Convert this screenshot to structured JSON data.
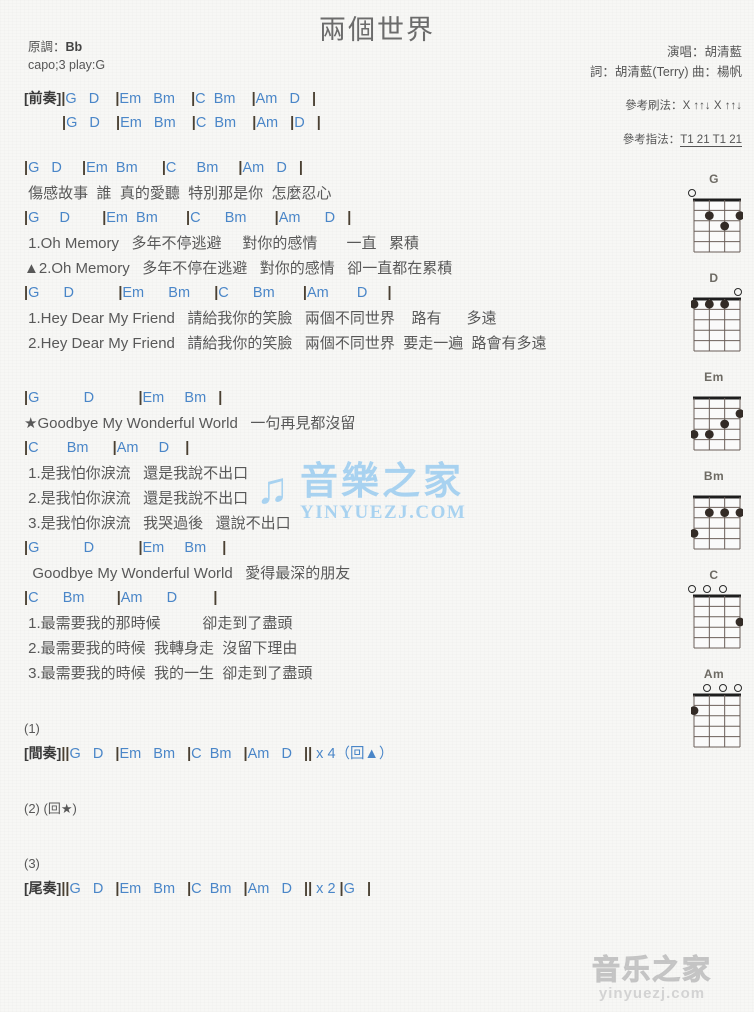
{
  "title": "兩個世界",
  "meta_left": {
    "key_label": "原調：",
    "key_value": "Bb",
    "capo": "capo;3 play:G"
  },
  "meta_right": {
    "singer": "演唱：胡清藍",
    "writer": "詞：胡清藍(Terry)  曲：楊帆",
    "strum_label": "參考刷法：",
    "strum_pattern": "X ↑↑↓ X ↑↑↓",
    "pick_label": "參考指法：",
    "pick_pattern": "T1 21 T1 21"
  },
  "sections": [
    {
      "tag": "[前奏]",
      "lines": [
        {
          "type": "chord",
          "text": "|G   D    |Em   Bm    |C  Bm    |Am   D   |"
        },
        {
          "type": "chord",
          "indent": true,
          "text": "|G   D    |Em   Bm    |C  Bm    |Am   |D   |"
        }
      ]
    },
    {
      "tag": "",
      "lines": [
        {
          "type": "chord",
          "text": "|G   D     |Em  Bm      |C     Bm     |Am   D   |"
        },
        {
          "type": "lyric",
          "text": " 傷感故事  誰  真的愛聽  特別那是你  怎麼忍心"
        },
        {
          "type": "chord",
          "text": "|G     D        |Em  Bm       |C      Bm       |Am      D   |"
        },
        {
          "type": "lyric",
          "text": " 1.Oh Memory   多年不停逃避     對你的感情       一直   累積"
        },
        {
          "type": "lyric",
          "text": "▲2.Oh Memory   多年不停在逃避   對你的感情   卻一直都在累積"
        },
        {
          "type": "chord",
          "text": "|G      D           |Em      Bm      |C      Bm       |Am       D     |"
        },
        {
          "type": "lyric",
          "text": " 1.Hey Dear My Friend   請給我你的笑臉   兩個不同世界    路有      多遠"
        },
        {
          "type": "lyric",
          "text": " 2.Hey Dear My Friend   請給我你的笑臉   兩個不同世界  要走一遍  路會有多遠"
        }
      ]
    },
    {
      "tag": "",
      "lines": [
        {
          "type": "chord",
          "text": "|G           D           |Em     Bm   |"
        },
        {
          "type": "lyric",
          "text": "★Goodbye My Wonderful World   一句再見都沒留"
        },
        {
          "type": "chord",
          "text": "|C       Bm      |Am     D    |"
        },
        {
          "type": "lyric",
          "text": " 1.是我怕你淚流   還是我說不出口"
        },
        {
          "type": "lyric",
          "text": " 2.是我怕你淚流   還是我說不出口"
        },
        {
          "type": "lyric",
          "text": " 3.是我怕你淚流   我哭過後   還說不出口"
        },
        {
          "type": "chord",
          "text": "|G           D           |Em     Bm    |"
        },
        {
          "type": "lyric",
          "text": "  Goodbye My Wonderful World   愛得最深的朋友"
        },
        {
          "type": "chord",
          "text": "|C      Bm        |Am      D         |"
        },
        {
          "type": "lyric",
          "text": " 1.最需要我的那時候          卻走到了盡頭"
        },
        {
          "type": "lyric",
          "text": " 2.最需要我的時候  我轉身走  沒留下理由"
        },
        {
          "type": "lyric",
          "text": " 3.最需要我的時候  我的一生  卻走到了盡頭"
        }
      ]
    }
  ],
  "endings": [
    {
      "num": "(1)",
      "tag": "[間奏]",
      "text": "||G   D   |Em   Bm   |C  Bm   |Am   D   || x 4（回▲）"
    },
    {
      "num": "(2) (回★)",
      "tag": "",
      "text": ""
    },
    {
      "num": "(3)",
      "tag": "[尾奏]",
      "text": "||G   D   |Em   Bm   |C  Bm   |Am   D   || x 2 |G   |"
    }
  ],
  "diagrams": [
    {
      "name": "G",
      "open": [
        1,
        0,
        0,
        0
      ],
      "dots": [
        {
          "s": 2,
          "f": 2
        },
        {
          "s": 4,
          "f": 2
        },
        {
          "s": 3,
          "f": 3
        }
      ]
    },
    {
      "name": "D",
      "open": [
        0,
        0,
        0,
        1
      ],
      "dots": [
        {
          "s": 1,
          "f": 1
        },
        {
          "s": 2,
          "f": 1
        },
        {
          "s": 3,
          "f": 1
        }
      ]
    },
    {
      "name": "Em",
      "open": [
        0,
        0,
        0,
        0
      ],
      "dots": [
        {
          "s": 4,
          "f": 2
        },
        {
          "s": 3,
          "f": 3
        },
        {
          "s": 1,
          "f": 4
        },
        {
          "s": 2,
          "f": 4
        }
      ]
    },
    {
      "name": "Bm",
      "open": [
        0,
        0,
        0,
        0
      ],
      "dots": [
        {
          "s": 2,
          "f": 2
        },
        {
          "s": 3,
          "f": 2
        },
        {
          "s": 4,
          "f": 2
        },
        {
          "s": 1,
          "f": 4
        }
      ]
    },
    {
      "name": "C",
      "open": [
        1,
        1,
        1,
        0
      ],
      "dots": [
        {
          "s": 4,
          "f": 3
        }
      ]
    },
    {
      "name": "Am",
      "open": [
        0,
        1,
        1,
        1
      ],
      "dots": [
        {
          "s": 1,
          "f": 2
        }
      ]
    }
  ],
  "watermarks": {
    "center_text": "音樂之家",
    "center_url": "YINYUEZJ.COM",
    "bottom_text": "音乐之家",
    "bottom_url": "yinyuezj.com"
  },
  "colors": {
    "chord": "#4a86c8",
    "lyric": "#585858",
    "bar": "#4a4032",
    "watermark_blue": "#a8d2f0",
    "watermark_gray": "#cfcfcf"
  }
}
